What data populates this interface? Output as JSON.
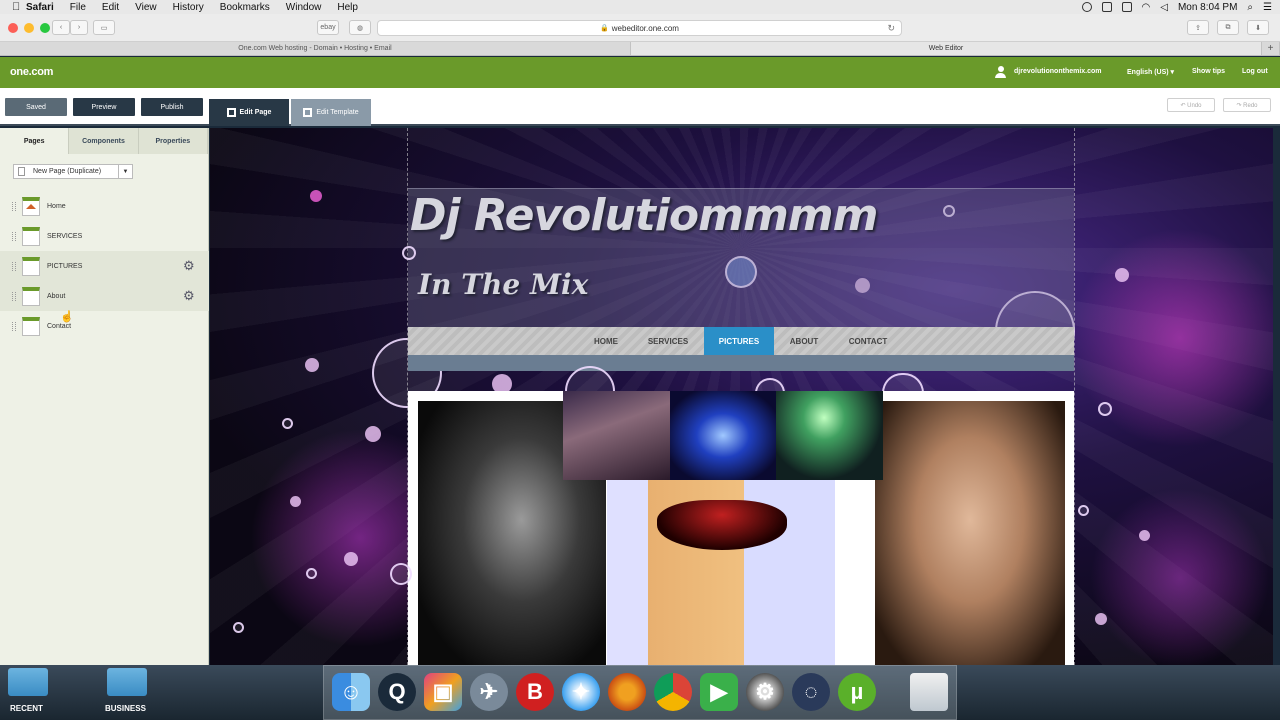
{
  "menubar": {
    "app": "Safari",
    "items": [
      "File",
      "Edit",
      "View",
      "History",
      "Bookmarks",
      "Window",
      "Help"
    ],
    "clock": "Mon 8:04 PM"
  },
  "browser": {
    "url": "webeditor.one.com",
    "small_btn": "ebay",
    "tabs": [
      "One.com Web hosting  -  Domain • Hosting • Email",
      "Web Editor"
    ],
    "tab_plus": "+"
  },
  "onecom": {
    "logo": "one.com",
    "user": "djrevolutiononthemix.com",
    "language": "English (US) ▾",
    "show_tips": "Show tips",
    "logout": "Log out"
  },
  "editor": {
    "saved": "Saved",
    "preview": "Preview",
    "publish": "Publish",
    "edit_page": "Edit Page",
    "edit_template": "Edit Template",
    "undo": "↶ Undo",
    "redo": "↷ Redo"
  },
  "sidebar": {
    "tabs": [
      "Pages",
      "Components",
      "Properties"
    ],
    "new_page": "New Page (Duplicate)",
    "pages": [
      "Home",
      "SERVICES",
      "PICTURES",
      "About",
      "Contact"
    ]
  },
  "site": {
    "title_line1": "Dj Revolutiommmm",
    "title_line2": "In The Mix",
    "nav": [
      "HOME",
      "SERVICES",
      "PICTURES",
      "ABOUT",
      "CONTACT"
    ],
    "active_nav": "PICTURES"
  },
  "desktop": {
    "folders": [
      "RECENT",
      "BUSINESS"
    ]
  },
  "dock": {
    "apps": [
      "finder-icon",
      "quicktime-icon",
      "final-cut-icon",
      "launchpad-icon",
      "bbedit-icon",
      "safari-icon",
      "firefox-icon",
      "chrome-icon",
      "facetime-icon",
      "system-preferences-icon",
      "app-icon",
      "utorrent-icon",
      "trash-icon"
    ]
  },
  "colors": {
    "onecom_green": "#6a9a2a",
    "editor_dark": "#283846",
    "nav_active": "#2a8fc8"
  }
}
